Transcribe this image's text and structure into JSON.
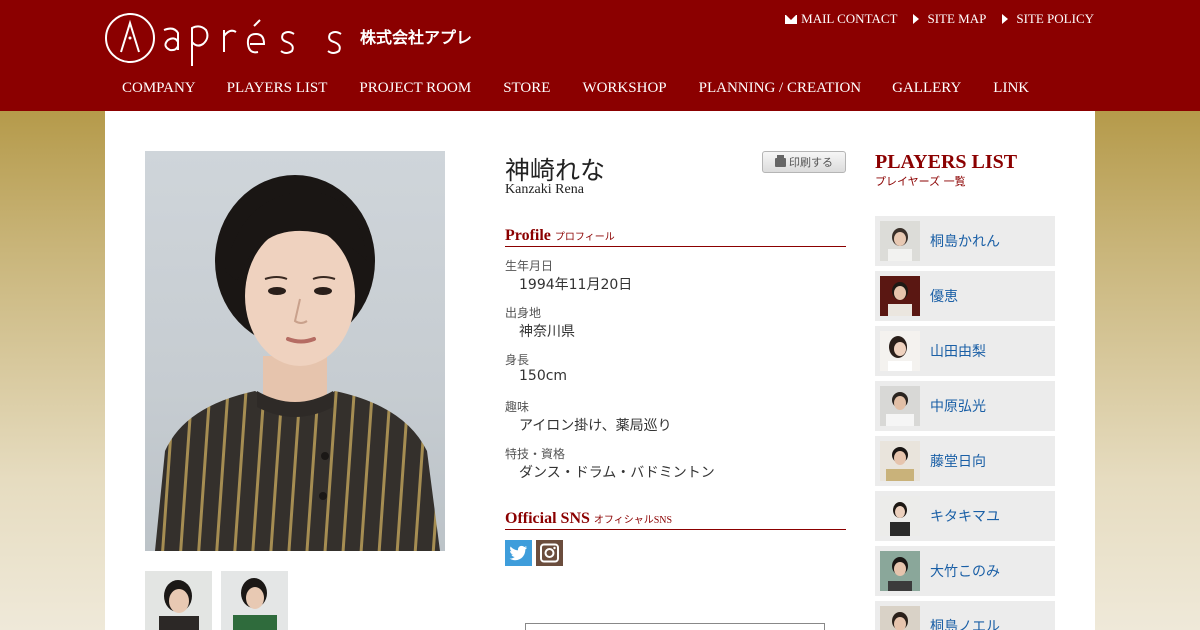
{
  "header": {
    "logo_text": "après",
    "company_name": "株式会社アプレ",
    "util_links": [
      {
        "label": "MAIL CONTACT",
        "icon": "mail-icon"
      },
      {
        "label": "SITE MAP",
        "icon": "triangle-right-icon"
      },
      {
        "label": "SITE POLICY",
        "icon": "triangle-right-icon"
      }
    ],
    "colors": {
      "header_bg": "#8b0000",
      "accent": "#8b0000",
      "link": "#1a5fa6"
    }
  },
  "nav": {
    "items": [
      "COMPANY",
      "PLAYERS LIST",
      "PROJECT ROOM",
      "STORE",
      "WORKSHOP",
      "PLANNING / CREATION",
      "GALLERY",
      "LINK"
    ]
  },
  "profile": {
    "name_jp": "神崎れな",
    "name_en": "Kanzaki Rena",
    "print_label": "印刷する",
    "section_title": "Profile",
    "section_sub": "プロフィール",
    "fields": [
      {
        "label": "生年月日",
        "value": "1994年11月20日"
      },
      {
        "label": "出身地",
        "value": "神奈川県"
      },
      {
        "label": "身長",
        "value": "150cm"
      },
      {
        "label": "趣味",
        "value": "アイロン掛け、薬局巡り"
      },
      {
        "label": "特技・資格",
        "value": "ダンス・ドラム・バドミントン"
      }
    ]
  },
  "sns": {
    "section_title": "Official SNS",
    "section_sub": "オフィシャルSNS",
    "icons": [
      "twitter-icon",
      "instagram-icon"
    ]
  },
  "sidebar": {
    "title": "PLAYERS LIST",
    "subtitle": "プレイヤーズ 一覧",
    "players": [
      "桐島かれん",
      "優恵",
      "山田由梨",
      "中原弘光",
      "藤堂日向",
      "キタキマユ",
      "大竹このみ",
      "桐島ノエル"
    ]
  }
}
